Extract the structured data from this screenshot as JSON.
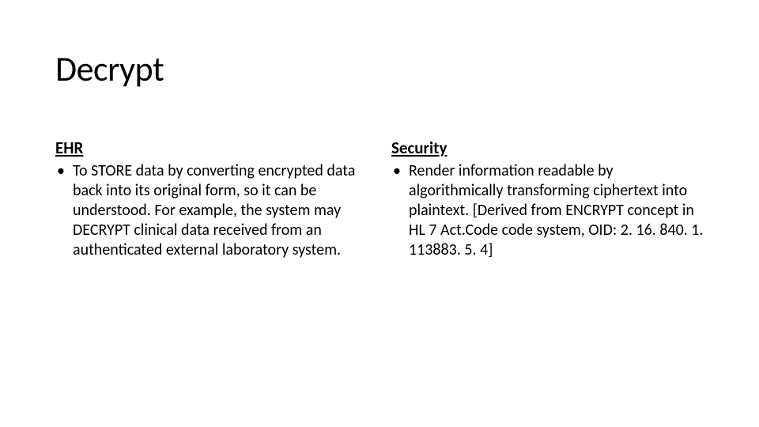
{
  "title": "Decrypt",
  "columns": {
    "left": {
      "heading": "EHR",
      "bullet_marker": "•",
      "bullet_text": "To STORE data by converting encrypted data back into its original form, so it can be understood. For example, the system may DECRYPT clinical data received from an authenticated external laboratory system."
    },
    "right": {
      "heading": "Security",
      "bullet_marker": "•",
      "bullet_text": "Render information readable by algorithmically transforming ciphertext into plaintext. [Derived from ENCRYPT concept in HL 7 Act.Code code system, OID: 2. 16. 840. 1. 113883. 5. 4]"
    }
  }
}
